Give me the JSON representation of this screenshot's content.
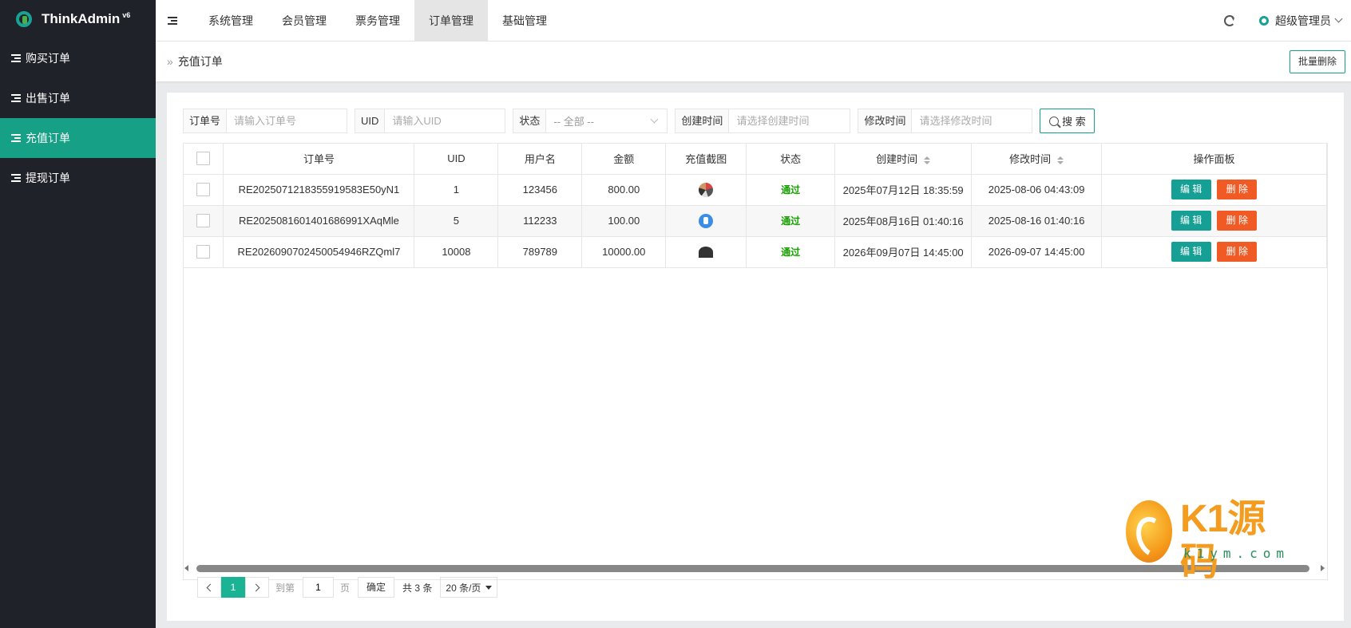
{
  "app": {
    "name": "ThinkAdmin",
    "version": "v6"
  },
  "sidebar": {
    "items": [
      {
        "label": "购买订单",
        "active": false
      },
      {
        "label": "出售订单",
        "active": false
      },
      {
        "label": "充值订单",
        "active": true
      },
      {
        "label": "提现订单",
        "active": false
      }
    ]
  },
  "topnav": {
    "tabs": [
      {
        "label": "系统管理",
        "active": false
      },
      {
        "label": "会员管理",
        "active": false
      },
      {
        "label": "票务管理",
        "active": false
      },
      {
        "label": "订单管理",
        "active": true
      },
      {
        "label": "基础管理",
        "active": false
      }
    ],
    "user": "超级管理员"
  },
  "page": {
    "title": "充值订单",
    "batch_delete": "批量删除"
  },
  "search": {
    "order_label": "订单号",
    "order_placeholder": "请输入订单号",
    "uid_label": "UID",
    "uid_placeholder": "请输入UID",
    "status_label": "状态",
    "status_value": "-- 全部 --",
    "created_label": "创建时间",
    "created_placeholder": "请选择创建时间",
    "modified_label": "修改时间",
    "modified_placeholder": "请选择修改时间",
    "button": "搜 索"
  },
  "table": {
    "headers": {
      "order_no": "订单号",
      "uid": "UID",
      "username": "用户名",
      "amount": "金额",
      "screenshot": "充值截图",
      "status": "状态",
      "created": "创建时间",
      "modified": "修改时间",
      "actions": "操作面板"
    },
    "edit_label": "编 辑",
    "delete_label": "删 除",
    "rows": [
      {
        "order_no": "RE2025071218355919583E50yN1",
        "uid": "1",
        "username": "123456",
        "amount": "800.00",
        "status": "通过",
        "created": "2025年07月12日 18:35:59",
        "modified": "2025-08-06 04:43:09"
      },
      {
        "order_no": "RE2025081601401686991XAqMle",
        "uid": "5",
        "username": "112233",
        "amount": "100.00",
        "status": "通过",
        "created": "2025年08月16日 01:40:16",
        "modified": "2025-08-16 01:40:16"
      },
      {
        "order_no": "RE2026090702450054946RZQml7",
        "uid": "10008",
        "username": "789789",
        "amount": "10000.00",
        "status": "通过",
        "created": "2026年09月07日 14:45:00",
        "modified": "2026-09-07 14:45:00"
      }
    ]
  },
  "pager": {
    "current": "1",
    "goto_prefix": "到第",
    "goto_value": "1",
    "goto_suffix": "页",
    "confirm": "确定",
    "total": "共 3 条",
    "page_size": "20 条/页"
  },
  "watermark": {
    "main": "K1源码",
    "sub": "k1ym.com"
  }
}
